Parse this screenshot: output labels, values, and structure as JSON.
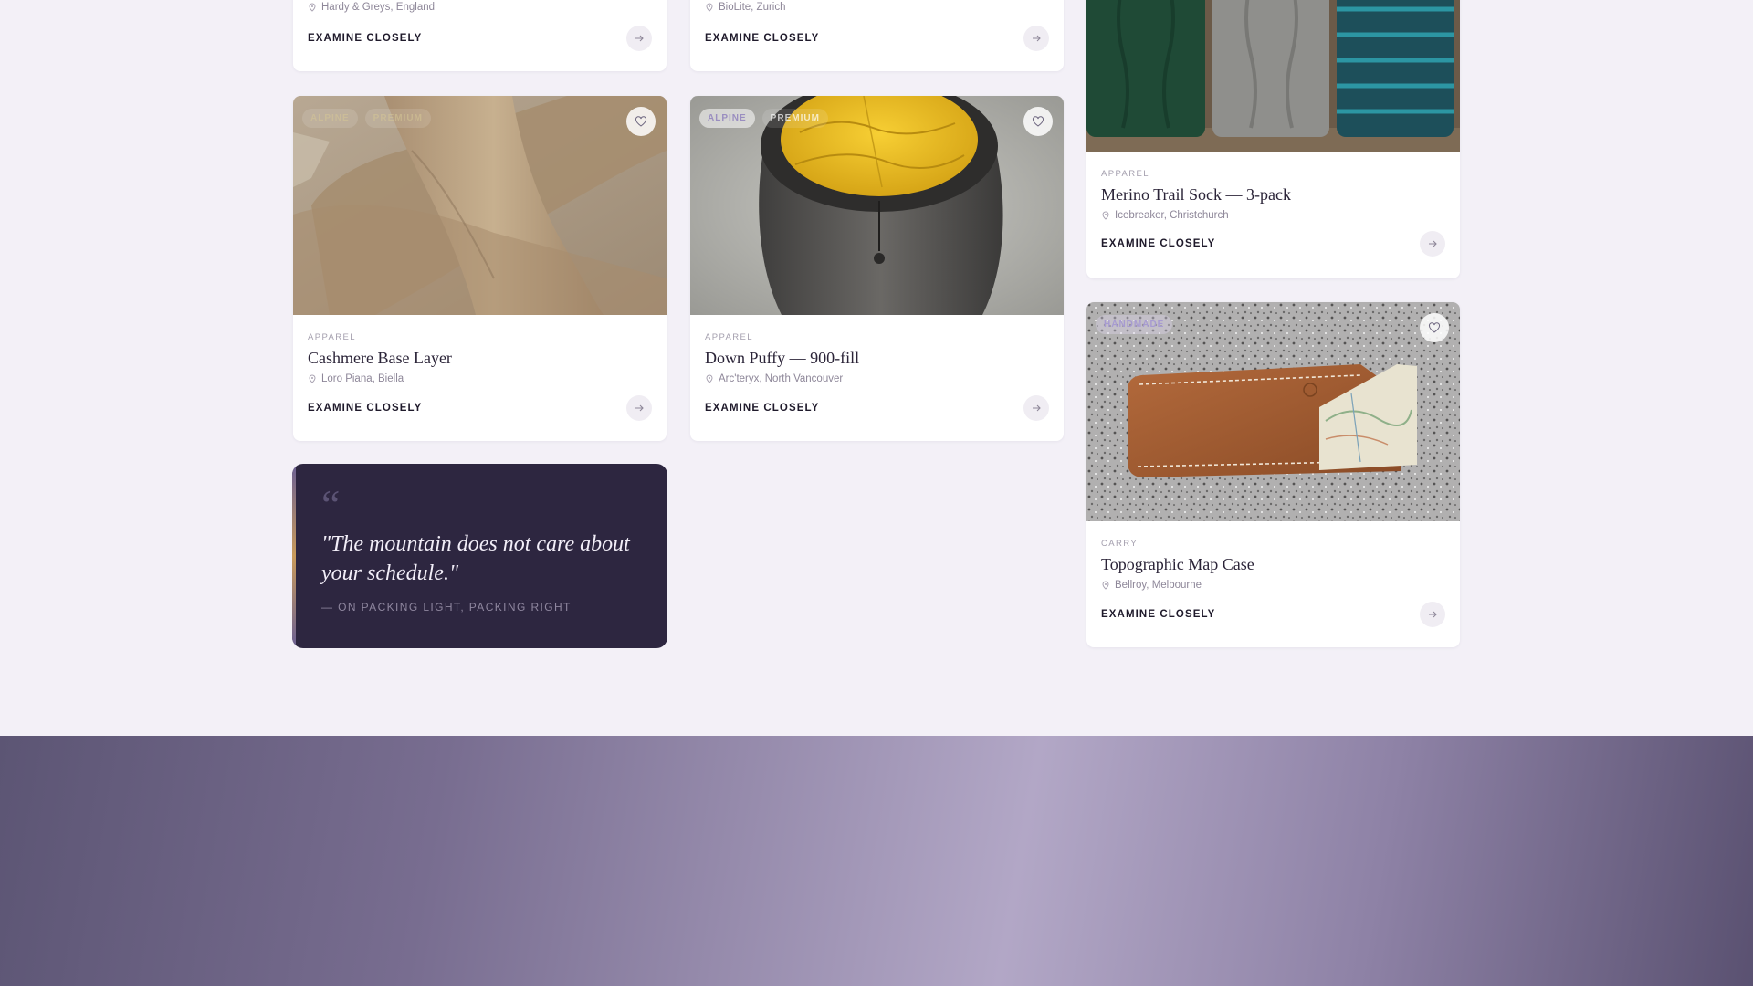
{
  "cards": [
    {
      "id": "partial-left",
      "location": "Hardy & Greys, England",
      "cta": "EXAMINE CLOSELY"
    },
    {
      "id": "partial-middle",
      "location": "BioLite, Zurich",
      "cta": "EXAMINE CLOSELY"
    },
    {
      "id": "cashmere",
      "tags": [
        "ALPINE",
        "PREMIUM"
      ],
      "category": "APPAREL",
      "title": "Cashmere Base Layer",
      "location": "Loro Piana, Biella",
      "cta": "EXAMINE CLOSELY"
    },
    {
      "id": "down-puffy",
      "tags": [
        "ALPINE",
        "PREMIUM"
      ],
      "category": "APPAREL",
      "title": "Down Puffy — 900-fill",
      "location": "Arc'teryx, North Vancouver",
      "cta": "EXAMINE CLOSELY"
    },
    {
      "id": "merino",
      "category": "APPAREL",
      "title": "Merino Trail Sock — 3-pack",
      "location": "Icebreaker, Christchurch",
      "cta": "EXAMINE CLOSELY"
    },
    {
      "id": "map-case",
      "tags": [
        "HANDMADE"
      ],
      "category": "CARRY",
      "title": "Topographic Map Case",
      "location": "Bellroy, Melbourne",
      "cta": "EXAMINE CLOSELY"
    }
  ],
  "quote": {
    "mark": "“",
    "text": "\"The mountain does not care about your schedule.\"",
    "attribution": "— ON PACKING LIGHT, PACKING RIGHT"
  },
  "icons": {
    "pin": "map-pin-icon",
    "arrow": "arrow-right-icon",
    "heart": "heart-icon"
  },
  "colors": {
    "background": "#f3f0f7",
    "quote_bg": "#2d2640",
    "accent": "#9a8ec0"
  }
}
